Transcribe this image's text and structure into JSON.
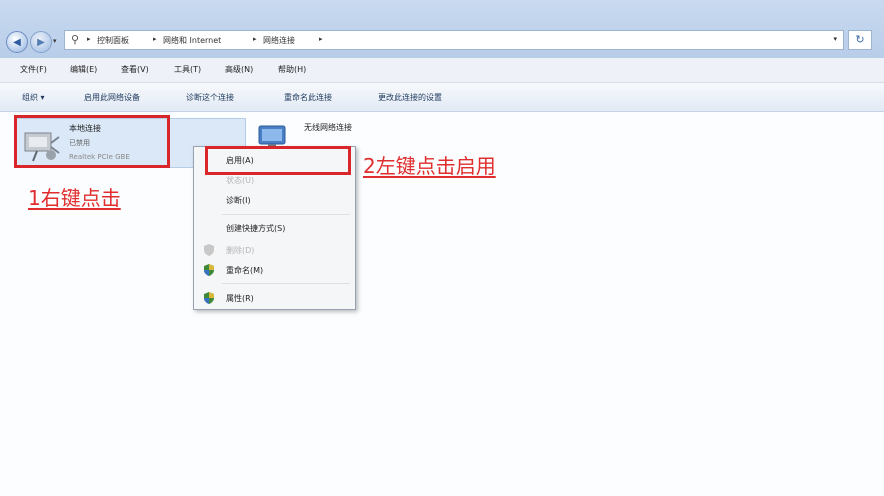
{
  "address": {
    "crumbs": [
      "控制面板",
      "网络和 Internet",
      "网络连接"
    ],
    "separator": "▸",
    "dropdown": "▾",
    "refresh_symbol": "↻"
  },
  "menu": [
    "文件(F)",
    "编辑(E)",
    "查看(V)",
    "工具(T)",
    "高级(N)",
    "帮助(H)"
  ],
  "commands": [
    "组织 ▾",
    "启用此网络设备",
    "诊断这个连接",
    "重命名此连接",
    "更改此连接的设置"
  ],
  "items": {
    "local": {
      "name": "本地连接",
      "status": "已禁用",
      "device": "Realtek PCIe GBE"
    },
    "wifi": {
      "name": "无线网络连接",
      "status": ""
    }
  },
  "context_menu": [
    {
      "label": "启用(A)",
      "enabled": true,
      "icon": ""
    },
    {
      "label": "状态(U)",
      "enabled": false,
      "icon": ""
    },
    {
      "label": "诊断(I)",
      "enabled": true,
      "icon": ""
    },
    {
      "label": "创建快捷方式(S)",
      "enabled": true,
      "icon": ""
    },
    {
      "label": "删除(D)",
      "enabled": false,
      "icon": "shield-icon"
    },
    {
      "label": "重命名(M)",
      "enabled": true,
      "icon": "shield-icon"
    },
    {
      "label": "属性(R)",
      "enabled": true,
      "icon": "shield-icon"
    }
  ],
  "annotations": {
    "step1": "1右键点击",
    "step2": "2左键点击启用"
  },
  "colors": {
    "annotation": "#e02d2d",
    "highlight": "#d9262b",
    "selection": "#dbe8f7"
  }
}
